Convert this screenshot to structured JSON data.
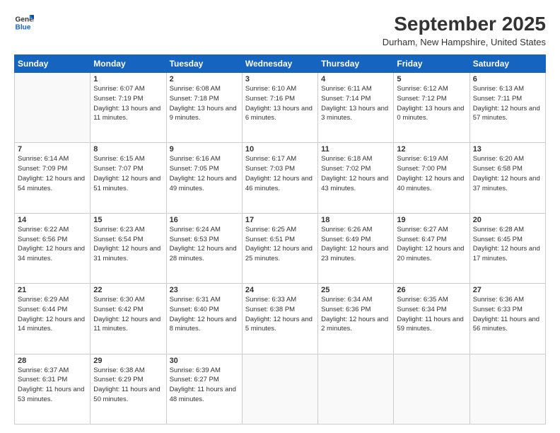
{
  "logo": {
    "line1": "General",
    "line2": "Blue"
  },
  "title": "September 2025",
  "location": "Durham, New Hampshire, United States",
  "days_of_week": [
    "Sunday",
    "Monday",
    "Tuesday",
    "Wednesday",
    "Thursday",
    "Friday",
    "Saturday"
  ],
  "weeks": [
    [
      {
        "day": "",
        "sunrise": "",
        "sunset": "",
        "daylight": ""
      },
      {
        "day": "1",
        "sunrise": "Sunrise: 6:07 AM",
        "sunset": "Sunset: 7:19 PM",
        "daylight": "Daylight: 13 hours and 11 minutes."
      },
      {
        "day": "2",
        "sunrise": "Sunrise: 6:08 AM",
        "sunset": "Sunset: 7:18 PM",
        "daylight": "Daylight: 13 hours and 9 minutes."
      },
      {
        "day": "3",
        "sunrise": "Sunrise: 6:10 AM",
        "sunset": "Sunset: 7:16 PM",
        "daylight": "Daylight: 13 hours and 6 minutes."
      },
      {
        "day": "4",
        "sunrise": "Sunrise: 6:11 AM",
        "sunset": "Sunset: 7:14 PM",
        "daylight": "Daylight: 13 hours and 3 minutes."
      },
      {
        "day": "5",
        "sunrise": "Sunrise: 6:12 AM",
        "sunset": "Sunset: 7:12 PM",
        "daylight": "Daylight: 13 hours and 0 minutes."
      },
      {
        "day": "6",
        "sunrise": "Sunrise: 6:13 AM",
        "sunset": "Sunset: 7:11 PM",
        "daylight": "Daylight: 12 hours and 57 minutes."
      }
    ],
    [
      {
        "day": "7",
        "sunrise": "Sunrise: 6:14 AM",
        "sunset": "Sunset: 7:09 PM",
        "daylight": "Daylight: 12 hours and 54 minutes."
      },
      {
        "day": "8",
        "sunrise": "Sunrise: 6:15 AM",
        "sunset": "Sunset: 7:07 PM",
        "daylight": "Daylight: 12 hours and 51 minutes."
      },
      {
        "day": "9",
        "sunrise": "Sunrise: 6:16 AM",
        "sunset": "Sunset: 7:05 PM",
        "daylight": "Daylight: 12 hours and 49 minutes."
      },
      {
        "day": "10",
        "sunrise": "Sunrise: 6:17 AM",
        "sunset": "Sunset: 7:03 PM",
        "daylight": "Daylight: 12 hours and 46 minutes."
      },
      {
        "day": "11",
        "sunrise": "Sunrise: 6:18 AM",
        "sunset": "Sunset: 7:02 PM",
        "daylight": "Daylight: 12 hours and 43 minutes."
      },
      {
        "day": "12",
        "sunrise": "Sunrise: 6:19 AM",
        "sunset": "Sunset: 7:00 PM",
        "daylight": "Daylight: 12 hours and 40 minutes."
      },
      {
        "day": "13",
        "sunrise": "Sunrise: 6:20 AM",
        "sunset": "Sunset: 6:58 PM",
        "daylight": "Daylight: 12 hours and 37 minutes."
      }
    ],
    [
      {
        "day": "14",
        "sunrise": "Sunrise: 6:22 AM",
        "sunset": "Sunset: 6:56 PM",
        "daylight": "Daylight: 12 hours and 34 minutes."
      },
      {
        "day": "15",
        "sunrise": "Sunrise: 6:23 AM",
        "sunset": "Sunset: 6:54 PM",
        "daylight": "Daylight: 12 hours and 31 minutes."
      },
      {
        "day": "16",
        "sunrise": "Sunrise: 6:24 AM",
        "sunset": "Sunset: 6:53 PM",
        "daylight": "Daylight: 12 hours and 28 minutes."
      },
      {
        "day": "17",
        "sunrise": "Sunrise: 6:25 AM",
        "sunset": "Sunset: 6:51 PM",
        "daylight": "Daylight: 12 hours and 25 minutes."
      },
      {
        "day": "18",
        "sunrise": "Sunrise: 6:26 AM",
        "sunset": "Sunset: 6:49 PM",
        "daylight": "Daylight: 12 hours and 23 minutes."
      },
      {
        "day": "19",
        "sunrise": "Sunrise: 6:27 AM",
        "sunset": "Sunset: 6:47 PM",
        "daylight": "Daylight: 12 hours and 20 minutes."
      },
      {
        "day": "20",
        "sunrise": "Sunrise: 6:28 AM",
        "sunset": "Sunset: 6:45 PM",
        "daylight": "Daylight: 12 hours and 17 minutes."
      }
    ],
    [
      {
        "day": "21",
        "sunrise": "Sunrise: 6:29 AM",
        "sunset": "Sunset: 6:44 PM",
        "daylight": "Daylight: 12 hours and 14 minutes."
      },
      {
        "day": "22",
        "sunrise": "Sunrise: 6:30 AM",
        "sunset": "Sunset: 6:42 PM",
        "daylight": "Daylight: 12 hours and 11 minutes."
      },
      {
        "day": "23",
        "sunrise": "Sunrise: 6:31 AM",
        "sunset": "Sunset: 6:40 PM",
        "daylight": "Daylight: 12 hours and 8 minutes."
      },
      {
        "day": "24",
        "sunrise": "Sunrise: 6:33 AM",
        "sunset": "Sunset: 6:38 PM",
        "daylight": "Daylight: 12 hours and 5 minutes."
      },
      {
        "day": "25",
        "sunrise": "Sunrise: 6:34 AM",
        "sunset": "Sunset: 6:36 PM",
        "daylight": "Daylight: 12 hours and 2 minutes."
      },
      {
        "day": "26",
        "sunrise": "Sunrise: 6:35 AM",
        "sunset": "Sunset: 6:34 PM",
        "daylight": "Daylight: 11 hours and 59 minutes."
      },
      {
        "day": "27",
        "sunrise": "Sunrise: 6:36 AM",
        "sunset": "Sunset: 6:33 PM",
        "daylight": "Daylight: 11 hours and 56 minutes."
      }
    ],
    [
      {
        "day": "28",
        "sunrise": "Sunrise: 6:37 AM",
        "sunset": "Sunset: 6:31 PM",
        "daylight": "Daylight: 11 hours and 53 minutes."
      },
      {
        "day": "29",
        "sunrise": "Sunrise: 6:38 AM",
        "sunset": "Sunset: 6:29 PM",
        "daylight": "Daylight: 11 hours and 50 minutes."
      },
      {
        "day": "30",
        "sunrise": "Sunrise: 6:39 AM",
        "sunset": "Sunset: 6:27 PM",
        "daylight": "Daylight: 11 hours and 48 minutes."
      },
      {
        "day": "",
        "sunrise": "",
        "sunset": "",
        "daylight": ""
      },
      {
        "day": "",
        "sunrise": "",
        "sunset": "",
        "daylight": ""
      },
      {
        "day": "",
        "sunrise": "",
        "sunset": "",
        "daylight": ""
      },
      {
        "day": "",
        "sunrise": "",
        "sunset": "",
        "daylight": ""
      }
    ]
  ]
}
